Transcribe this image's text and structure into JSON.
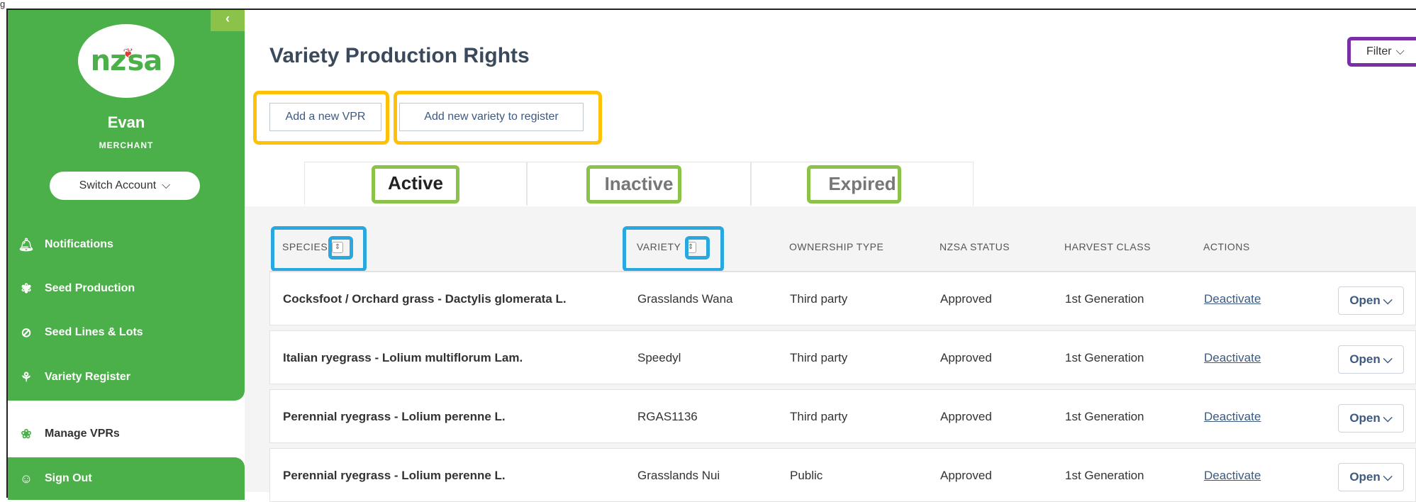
{
  "figure_label": "g",
  "sidebar": {
    "collapse_icon": "chevron-left-icon",
    "collapse_glyph": "‹",
    "logo_text_left": "nz",
    "logo_leaf": "❦",
    "logo_text_right": "sa",
    "user_name": "Evan",
    "user_role": "MERCHANT",
    "switch_account_label": "Switch Account",
    "chevron": "⌵",
    "nav_items": [
      {
        "label": "Notifications",
        "icon": "bell-icon",
        "glyph": "🔔︎"
      },
      {
        "label": "Seed Production",
        "icon": "sprout-icon",
        "glyph": "✾"
      },
      {
        "label": "Seed Lines & Lots",
        "icon": "tag-icon",
        "glyph": "⊘"
      },
      {
        "label": "Variety Register",
        "icon": "plant-icon",
        "glyph": "⚘"
      },
      {
        "label": "Manage VPRs",
        "icon": "hand-plant-icon",
        "glyph": "❀"
      },
      {
        "label": "Sign Out",
        "icon": "user-icon",
        "glyph": "☺"
      }
    ]
  },
  "header": {
    "title": "Variety Production Rights",
    "filter_label": "Filter",
    "filter_chevron": "⌵"
  },
  "actions": {
    "add_vpr_label": "Add a new VPR",
    "add_variety_label": "Add new variety to register"
  },
  "tabs": [
    {
      "label": "Active",
      "selected": true
    },
    {
      "label": "Inactive",
      "selected": false
    },
    {
      "label": "Expired",
      "selected": false
    }
  ],
  "table": {
    "columns": [
      "SPECIES",
      "VARIETY",
      "OWNERSHIP TYPE",
      "NZSA STATUS",
      "HARVEST CLASS",
      "ACTIONS"
    ],
    "sort_glyph": "⇕",
    "rows": [
      {
        "species": "Cocksfoot / Orchard grass - Dactylis glomerata L.",
        "variety": "Grasslands Wana",
        "ownership": "Third party",
        "status": "Approved",
        "harvest": "1st Generation",
        "action": "Deactivate",
        "open": "Open"
      },
      {
        "species": "Italian ryegrass - Lolium multiflorum Lam.",
        "variety": "Speedyl",
        "ownership": "Third party",
        "status": "Approved",
        "harvest": "1st Generation",
        "action": "Deactivate",
        "open": "Open"
      },
      {
        "species": "Perennial ryegrass - Lolium perenne L.",
        "variety": "RGAS1136",
        "ownership": "Third party",
        "status": "Approved",
        "harvest": "1st Generation",
        "action": "Deactivate",
        "open": "Open"
      },
      {
        "species": "Perennial ryegrass - Lolium perenne L.",
        "variety": "Grasslands Nui",
        "ownership": "Public",
        "status": "Approved",
        "harvest": "1st Generation",
        "action": "Deactivate",
        "open": "Open"
      }
    ]
  },
  "colors": {
    "sidebar_green": "#4cb04a",
    "highlight_yellow": "#ffc107",
    "highlight_green": "#8bc34a",
    "highlight_blue": "#29a8e0",
    "highlight_purple": "#7b2fa6"
  }
}
